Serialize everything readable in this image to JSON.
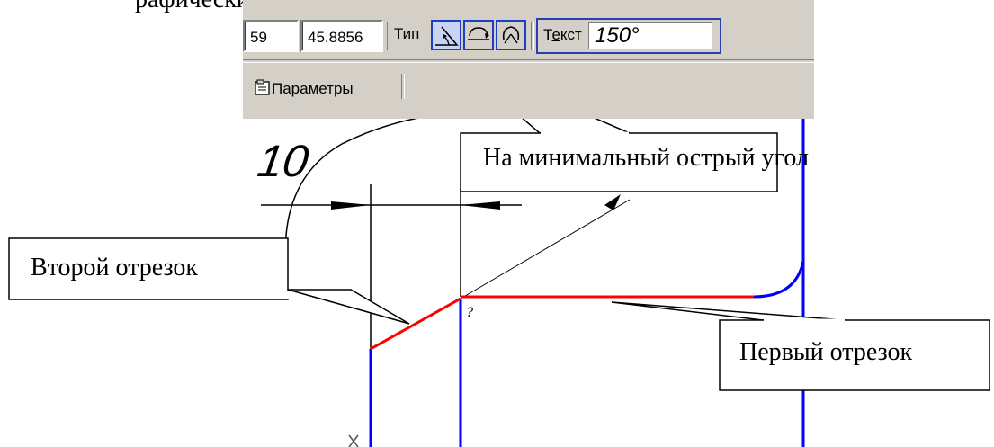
{
  "top_text": "рафические элементы следу",
  "toolbar": {
    "field_left_value": "59",
    "field_right_value": "45.8856",
    "type_label_prefix": "Т",
    "type_label_underlined": "ип",
    "text_label_prefix": "Т",
    "text_label_underlined": "е",
    "text_label_suffix": "кст",
    "text_value": "150°",
    "params_label": "Параметры",
    "type_buttons": [
      "angle-acute-icon",
      "angle-obtuse-icon",
      "angle-max-icon"
    ]
  },
  "drawing": {
    "dimension_value": "10",
    "corner_mark": "?"
  },
  "callouts": {
    "min_acute_angle": "На минимальный острый угол",
    "second_segment": "Второй отрезок",
    "first_segment": "Первый отрезок"
  },
  "colors": {
    "toolbar_bg": "#d4d0c8",
    "selection_blue": "#1c3dc4",
    "construction_blue": "#0000ff",
    "segment_red": "#ff0000"
  }
}
